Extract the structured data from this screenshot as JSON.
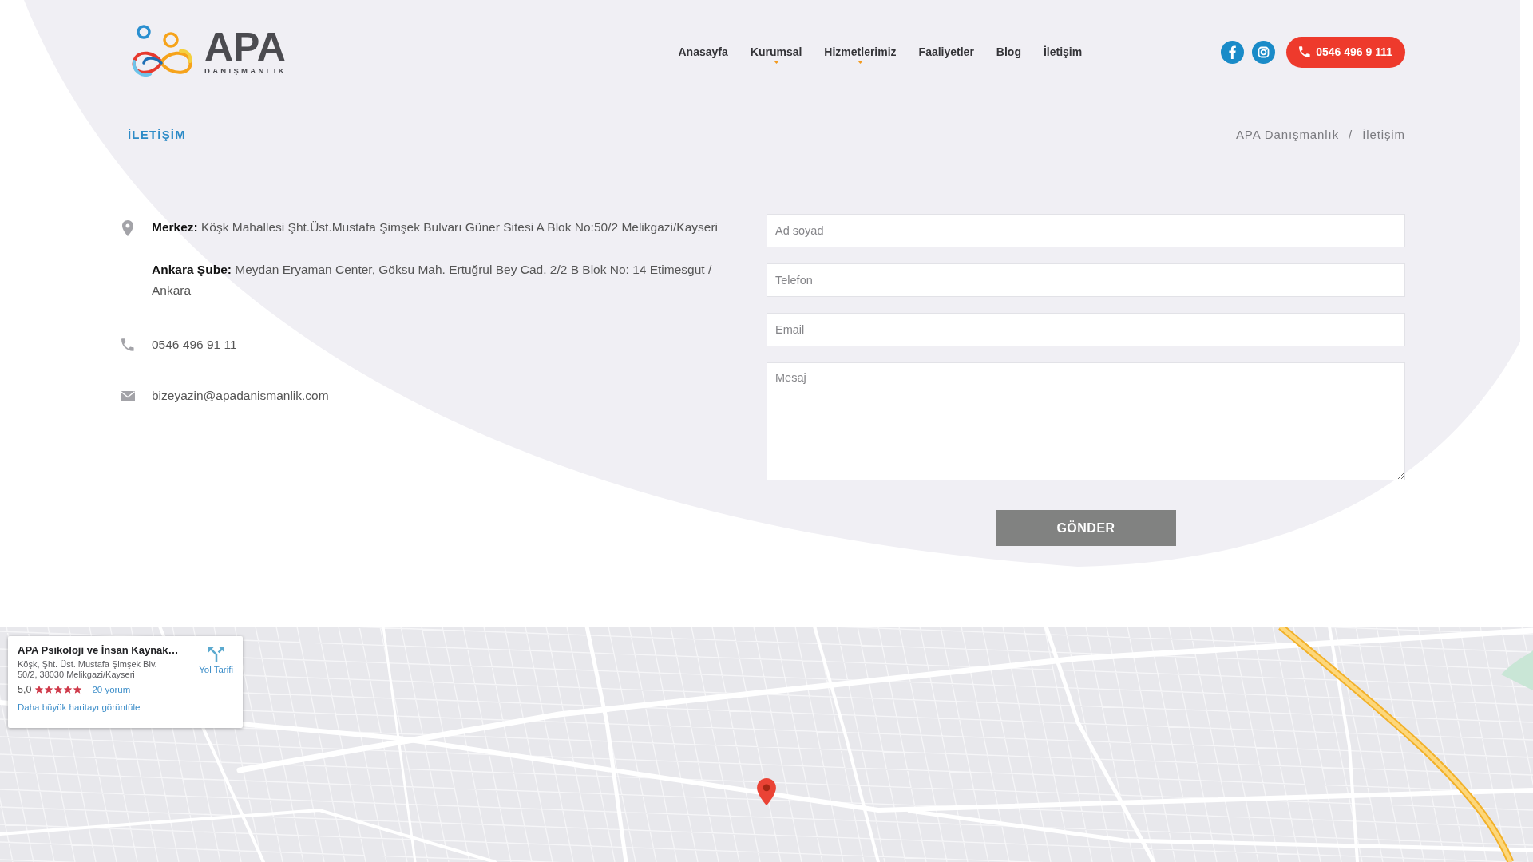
{
  "header": {
    "logo": {
      "title": "APA",
      "subtitle": "DANIŞMANLIK"
    },
    "nav": [
      {
        "label": "Anasayfa",
        "has_submenu": false
      },
      {
        "label": "Kurumsal",
        "has_submenu": true
      },
      {
        "label": "Hizmetlerimiz",
        "has_submenu": true
      },
      {
        "label": "Faaliyetler",
        "has_submenu": false
      },
      {
        "label": "Blog",
        "has_submenu": false
      },
      {
        "label": "İletişim",
        "has_submenu": false
      }
    ],
    "social": [
      {
        "kind": "facebook"
      },
      {
        "kind": "instagram"
      }
    ],
    "phone_button": "0546 496 9 111"
  },
  "title_bar": {
    "title": "İLETİŞİM",
    "breadcrumb": [
      {
        "label": "APA Danışmanlık"
      },
      {
        "label": "İletişim"
      }
    ],
    "separator": "/"
  },
  "contact": [
    {
      "kind": "address",
      "paragraphs": [
        "**Merkez:** Köşk Mahallesi Şht.Üst.Mustafa Şimşek Bulvarı Güner Sitesi A Blok No:50/2 Melikgazi/Kayseri",
        "**Ankara Şube:** Meydan Eryaman Center, Göksu Mah. Ertuğrul Bey Cad. 2/2 B Blok No: 14 Etimesgut / Ankara"
      ]
    },
    {
      "kind": "phone",
      "text": "0546 496 91 11"
    },
    {
      "kind": "email",
      "text": "bizeyazin@apadanismanlik.com"
    }
  ],
  "form": {
    "fields": [
      {
        "kind": "input",
        "placeholder": "Ad soyad"
      },
      {
        "kind": "input",
        "placeholder": "Telefon"
      },
      {
        "kind": "input",
        "placeholder": "Email"
      },
      {
        "kind": "textarea",
        "placeholder": "Mesaj"
      }
    ],
    "submit": "GÖNDER"
  },
  "map": {
    "info_card": {
      "title": "APA Psikoloji ve İnsan Kaynak…",
      "address_lines": [
        "Köşk, Şht. Üst. Mustafa Şimşek Blv.",
        "50/2, 38030 Melikgazi/Kayseri"
      ],
      "rating": "5,0",
      "stars": 5,
      "reviews": "20 yorum",
      "directions": "Yol Tarifi",
      "larger_map": "Daha büyük haritayı görüntüle"
    }
  }
}
